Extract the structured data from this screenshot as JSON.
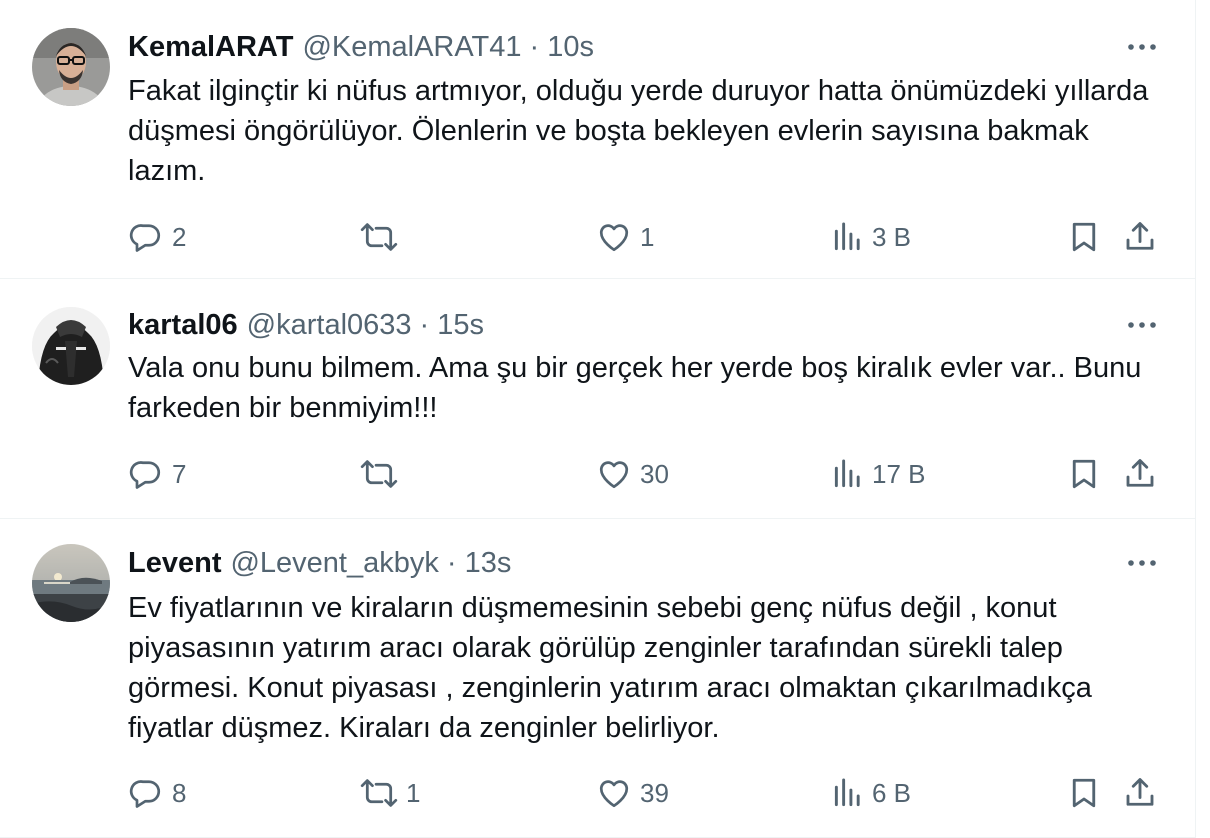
{
  "tweets": [
    {
      "name": "KemalARAT",
      "handle": "@KemalARAT41",
      "time": "10s",
      "text": "Fakat ilginçtir ki nüfus artmıyor, olduğu yerde duruyor hatta önümüzdeki yıllarda düşmesi öngörülüyor. Ölenlerin ve boşta bekleyen evlerin sayısına bakmak lazım.",
      "replies": "2",
      "retweets": "",
      "likes": "1",
      "views": "3 B"
    },
    {
      "name": "kartal06",
      "handle": "@kartal0633",
      "time": "15s",
      "text": "Vala onu bunu bilmem. Ama şu bir gerçek her yerde boş kiralık evler var.. Bunu farkeden bir benmiyim!!!",
      "replies": "7",
      "retweets": "",
      "likes": "30",
      "views": "17 B"
    },
    {
      "name": "Levent",
      "handle": "@Levent_akbyk",
      "time": "13s",
      "text": "Ev fiyatlarının ve kiraların düşmemesinin sebebi genç nüfus değil , konut piyasasının  yatırım aracı olarak görülüp zenginler tarafından sürekli talep görmesi. Konut piyasası , zenginlerin yatırım aracı olmaktan çıkarılmadıkça fiyatlar düşmez. Kiraları da zenginler belirliyor.",
      "replies": "8",
      "retweets": "1",
      "likes": "39",
      "views": "6 B"
    }
  ],
  "separator": "·",
  "icons": {
    "reply": "reply-icon",
    "retweet": "retweet-icon",
    "like": "like-icon",
    "views": "views-icon",
    "bookmark": "bookmark-icon",
    "share": "share-icon",
    "more": "more-icon"
  },
  "colors": {
    "text": "#0f1419",
    "secondary": "#536471",
    "border": "#eff3f4"
  }
}
